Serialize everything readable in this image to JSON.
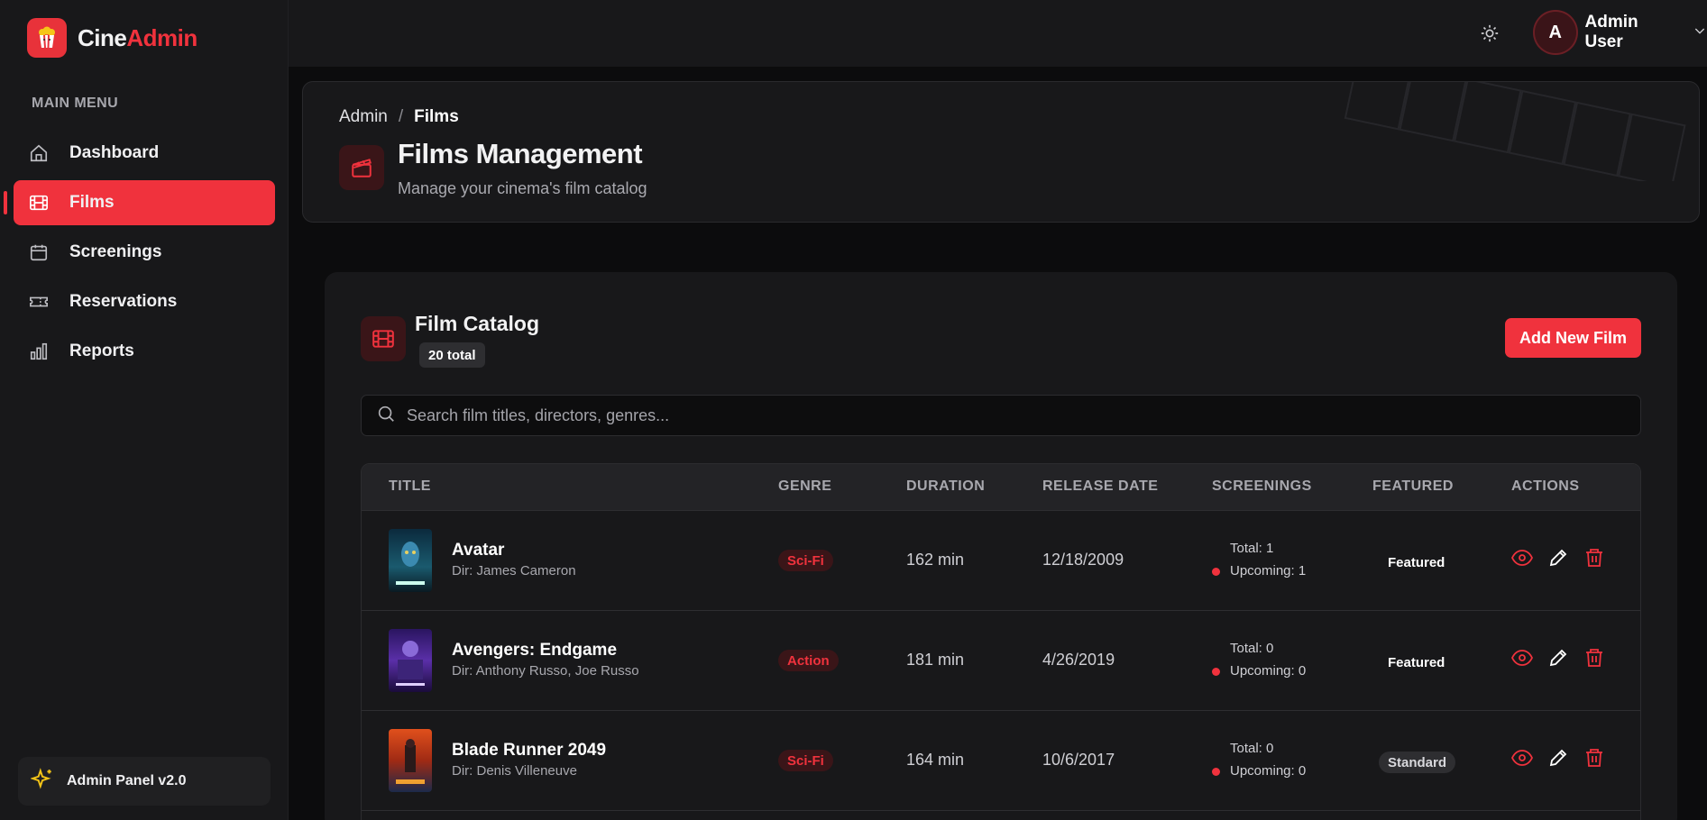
{
  "brand": {
    "name_part1": "Cine",
    "name_part2": "Admin"
  },
  "sidebar": {
    "heading": "MAIN MENU",
    "items": [
      {
        "label": "Dashboard",
        "icon": "home-icon"
      },
      {
        "label": "Films",
        "icon": "film-icon",
        "active": true
      },
      {
        "label": "Screenings",
        "icon": "calendar-icon"
      },
      {
        "label": "Reservations",
        "icon": "ticket-icon"
      },
      {
        "label": "Reports",
        "icon": "bar-chart-icon"
      }
    ],
    "version_label": "Admin Panel v2.0"
  },
  "topbar": {
    "user_initial": "A",
    "user_name": "Admin User"
  },
  "header": {
    "breadcrumb": {
      "root": "Admin",
      "separator": "/",
      "current": "Films"
    },
    "title": "Films Management",
    "subtitle": "Manage your cinema's film catalog"
  },
  "catalog": {
    "title": "Film Catalog",
    "count": "20 total",
    "add_button": "Add New Film",
    "search_placeholder": "Search film titles, directors, genres...",
    "columns": [
      "TITLE",
      "GENRE",
      "DURATION",
      "RELEASE DATE",
      "SCREENINGS",
      "FEATURED",
      "ACTIONS"
    ],
    "rows": [
      {
        "title": "Avatar",
        "director": "Dir: James Cameron",
        "genre": "Sci-Fi",
        "duration": "162 min",
        "release": "12/18/2009",
        "total": "Total: 1",
        "upcoming": "Upcoming: 1",
        "featured": "Featured"
      },
      {
        "title": "Avengers: Endgame",
        "director": "Dir: Anthony Russo, Joe Russo",
        "genre": "Action",
        "duration": "181 min",
        "release": "4/26/2019",
        "total": "Total: 0",
        "upcoming": "Upcoming: 0",
        "featured": "Featured"
      },
      {
        "title": "Blade Runner 2049",
        "director": "Dir: Denis Villeneuve",
        "genre": "Sci-Fi",
        "duration": "164 min",
        "release": "10/6/2017",
        "total": "Total: 0",
        "upcoming": "Upcoming: 0",
        "featured": "Standard"
      }
    ]
  },
  "colors": {
    "accent": "#f0323d",
    "sidebar_bg": "#18181a",
    "page_bg": "#0c0c0d"
  }
}
